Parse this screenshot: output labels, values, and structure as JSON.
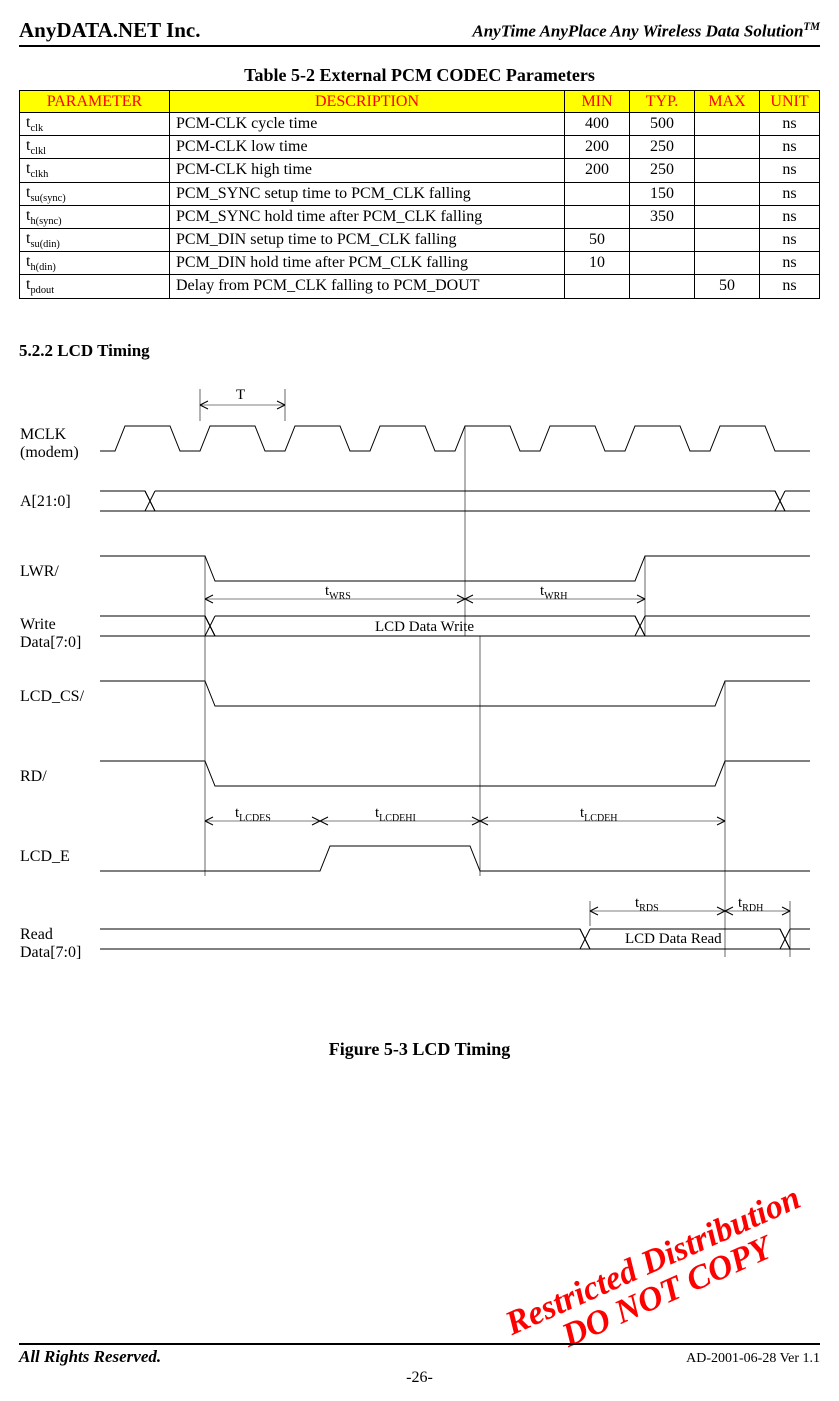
{
  "header": {
    "left": "AnyDATA.NET Inc.",
    "right_pre": "AnyTime AnyPlace Any Wireless Data Solution",
    "right_sup": "TM"
  },
  "table": {
    "caption": "Table 5-2 External PCM CODEC Parameters",
    "headers": {
      "param": "PARAMETER",
      "desc": "DESCRIPTION",
      "min": "MIN",
      "typ": "TYP.",
      "max": "MAX",
      "unit": "UNIT"
    },
    "rows": [
      {
        "p": "t",
        "sub": "clk",
        "desc": "PCM-CLK cycle time",
        "min": "400",
        "typ": "500",
        "max": "",
        "unit": "ns"
      },
      {
        "p": "t",
        "sub": "clkl",
        "desc": "PCM-CLK low time",
        "min": "200",
        "typ": "250",
        "max": "",
        "unit": "ns"
      },
      {
        "p": "t",
        "sub": "clkh",
        "desc": "PCM-CLK high time",
        "min": "200",
        "typ": "250",
        "max": "",
        "unit": "ns"
      },
      {
        "p": "t",
        "sub": "su(sync)",
        "desc": "PCM_SYNC setup time to PCM_CLK falling",
        "min": "",
        "typ": "150",
        "max": "",
        "unit": "ns"
      },
      {
        "p": "t",
        "sub": "h(sync)",
        "desc": "PCM_SYNC hold time after PCM_CLK falling",
        "min": "",
        "typ": "350",
        "max": "",
        "unit": "ns"
      },
      {
        "p": "t",
        "sub": "su(din)",
        "desc": "PCM_DIN setup time to PCM_CLK falling",
        "min": "50",
        "typ": "",
        "max": "",
        "unit": "ns"
      },
      {
        "p": "t",
        "sub": "h(din)",
        "desc": "PCM_DIN hold time after PCM_CLK falling",
        "min": "10",
        "typ": "",
        "max": "",
        "unit": "ns"
      },
      {
        "p": "t",
        "sub": "pdout",
        "desc": "Delay from PCM_CLK falling to PCM_DOUT",
        "min": "",
        "typ": "",
        "max": "50",
        "unit": "ns"
      }
    ]
  },
  "section_head": "5.2.2 LCD Timing",
  "timing": {
    "signals": {
      "mclk1": "MCLK",
      "mclk2": "(modem)",
      "addr": "A[21:0]",
      "lwr": "LWR/",
      "wdata1": "Write",
      "wdata2": "Data[7:0]",
      "lcd_cs": "LCD_CS/",
      "rd": "RD/",
      "lcd_e": "LCD_E",
      "rdata1": "Read",
      "rdata2": "Data[7:0]"
    },
    "labels": {
      "T": "T",
      "twrs": "t",
      "twrs_sub": "WRS",
      "twrh": "t",
      "twrh_sub": "WRH",
      "wdata": "LCD Data Write",
      "tlcdes": "t",
      "tlcdes_sub": "LCDES",
      "tlcdehi": "t",
      "tlcdehi_sub": "LCDEHI",
      "tlcdeh": "t",
      "tlcdeh_sub": "LCDEH",
      "trds": "t",
      "trds_sub": "RDS",
      "trdh": "t",
      "trdh_sub": "RDH",
      "rdata": "LCD Data Read"
    }
  },
  "figure_caption": "Figure 5-3 LCD Timing",
  "watermark": {
    "line1": "Restricted Distribution",
    "line2": "DO NOT COPY"
  },
  "footer": {
    "left": "All Rights Reserved.",
    "right": "AD-2001-06-28 Ver 1.1",
    "page": "-26-"
  }
}
